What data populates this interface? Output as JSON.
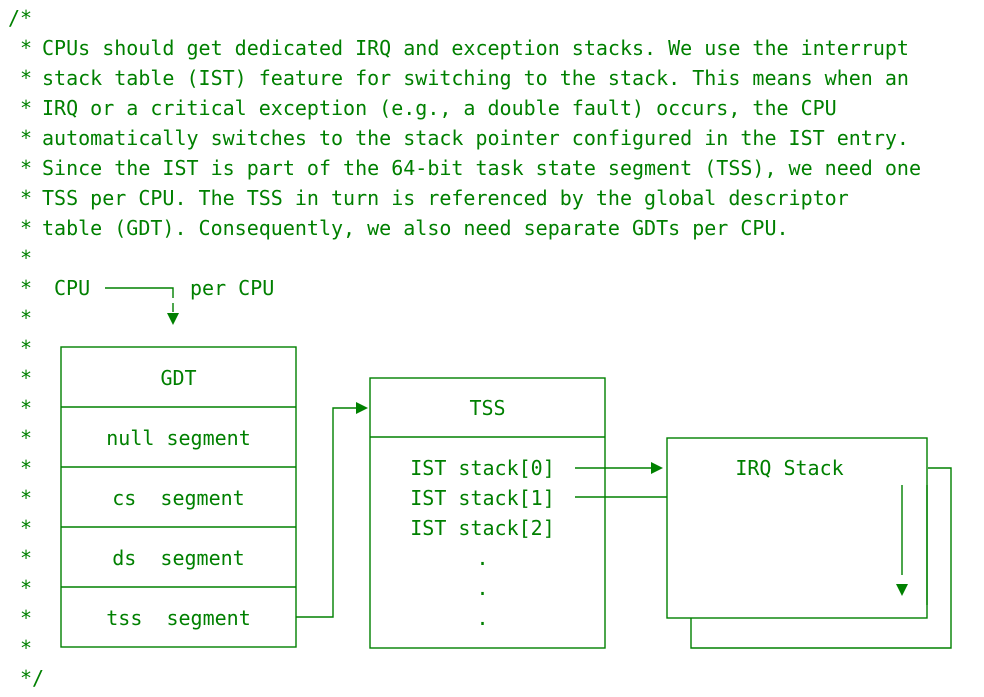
{
  "comment": {
    "open": "/*",
    "close": "*/",
    "gutter": "*",
    "paragraph": [
      "CPUs should get dedicated IRQ and exception stacks. We use the interrupt",
      "stack table (IST) feature for switching to the stack. This means when an",
      "IRQ or a critical exception (e.g., a double fault) occurs, the CPU",
      "automatically switches to the stack pointer configured in the IST entry.",
      "Since the IST is part of the 64-bit task state segment (TSS), we need one",
      "TSS per CPU. The TSS in turn is referenced by the global descriptor",
      "table (GDT). Consequently, we also need separate GDTs per CPU."
    ]
  },
  "diagram": {
    "cpu_label": "CPU",
    "per_cpu_label": "per CPU",
    "gdt": {
      "title": "GDT",
      "rows": [
        "null segment",
        "cs  segment",
        "ds  segment",
        "tss  segment"
      ]
    },
    "tss": {
      "title": "TSS",
      "entries": [
        "IST stack[0]",
        "IST stack[1]",
        "IST stack[2]",
        ".",
        ".",
        "."
      ]
    },
    "irq_stack": {
      "title": "IRQ Stack"
    }
  }
}
